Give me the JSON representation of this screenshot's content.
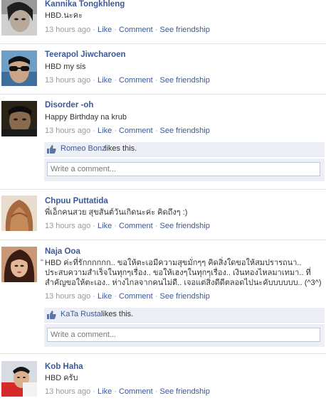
{
  "link_labels": {
    "like": "Like",
    "comment": "Comment",
    "see_friendship": "See friendship",
    "separator": "·"
  },
  "comment_placeholder": "Write a comment...",
  "likes_suffix": "likes this.",
  "posts": [
    {
      "author": "Kannika Tongkhleng",
      "text": "HBD.นะคะ",
      "time": "13 hours ago"
    },
    {
      "author": "Teerapol Jiwcharoen",
      "text": "HBD my sis",
      "time": "13 hours ago"
    },
    {
      "author": "Disorder -oh",
      "text": "Happy Birthday na krub",
      "time": "13 hours ago",
      "liked_by": "Romeo Bonz"
    },
    {
      "author": "Chpuu Puttatida",
      "text": "พี่เอ็กคนสวย สุขสันต์วันเกิดนะค่ะ คิดถึงๆ :)",
      "time": "13 hours ago"
    },
    {
      "author": "Naja Ooa",
      "text": "HBD ค่ะที่รักกกกกก.. ขอให้ตะเอมีความสุขมั่กๆๆ คิดสิ่งใดขอให้สมปรารถนา.. ประสบความสำเร็จในทุกๆเรื่อง.. ขอให้เฮงๆในทุกๆเรื่อง.. เงินทองไหลมาเทมา.. ที่สำคัญขอให้ตะเอง.. ห่างไกลจากคนไม่ดี.. เจอแต่สิ่งดีดีตลอดไปนะคับบบบบบ.. (^3^)",
      "time": "13 hours ago",
      "liked_by": "KaTa Rusta",
      "quote_mark": "“"
    },
    {
      "author": "Kob Haha",
      "text": "HBD ครับ",
      "time": "13 hours ago"
    }
  ],
  "colors": {
    "link": "#3b5998",
    "meta": "#999999",
    "likebox_bg": "#eceff5",
    "divider": "#e5e5e5"
  },
  "icons": {
    "like": "thumbs-up-icon"
  }
}
